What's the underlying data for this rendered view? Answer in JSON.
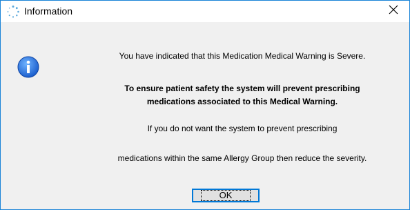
{
  "window": {
    "title": "Information",
    "accent_color": "#1883d7",
    "title_icon": "spinner-dots-icon",
    "close_icon": "close-icon"
  },
  "dialog": {
    "icon": "info-icon",
    "line1": "You have indicated that this Medication Medical Warning is Severe.",
    "bold_line1": "To ensure patient safety the system will prevent prescribing",
    "bold_line2": "medications associated to this Medical Warning.",
    "line3": "If you do not want the system to prevent prescribing",
    "line4": "medications within the same Allergy Group then reduce the severity.",
    "ok_label": "OK"
  }
}
